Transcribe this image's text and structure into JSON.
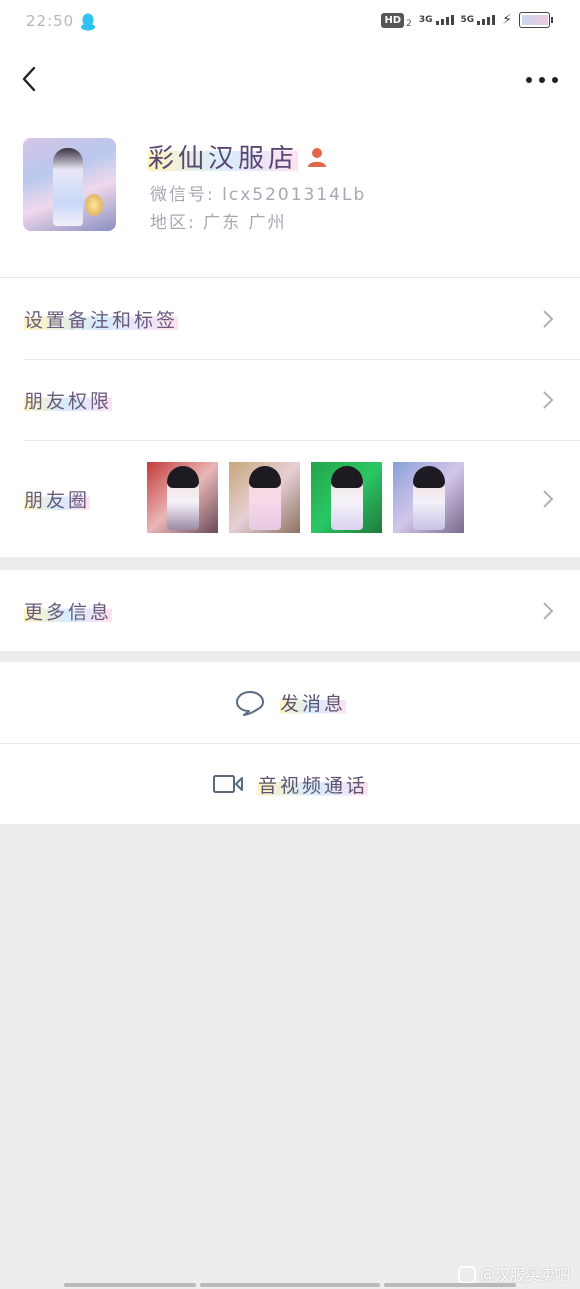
{
  "status_bar": {
    "time": "22:50",
    "hd_badge": "HD",
    "hd_sub": "2",
    "signal_1": "3G",
    "signal_2": "5G"
  },
  "nav": {
    "back_icon": "chevron-left-icon",
    "more_icon": "ellipsis-icon"
  },
  "profile": {
    "name": "彩仙汉服店",
    "wechat_id": "微信号: lcx5201314Lb",
    "region": "地区: 广东 广州"
  },
  "menu": {
    "items": [
      {
        "label": "设置备注和标签"
      },
      {
        "label": "朋友权限"
      },
      {
        "label": "朋友圈"
      }
    ],
    "more_info": "更多信息"
  },
  "actions": {
    "send_message": "发消息",
    "video_call": "音视频通话"
  },
  "watermark": {
    "text": "@汉服买卖吧"
  },
  "colors": {
    "accent_text": "#5a4872",
    "gender_icon": "#e2674a",
    "qq_icon": "#2fc1f0"
  }
}
